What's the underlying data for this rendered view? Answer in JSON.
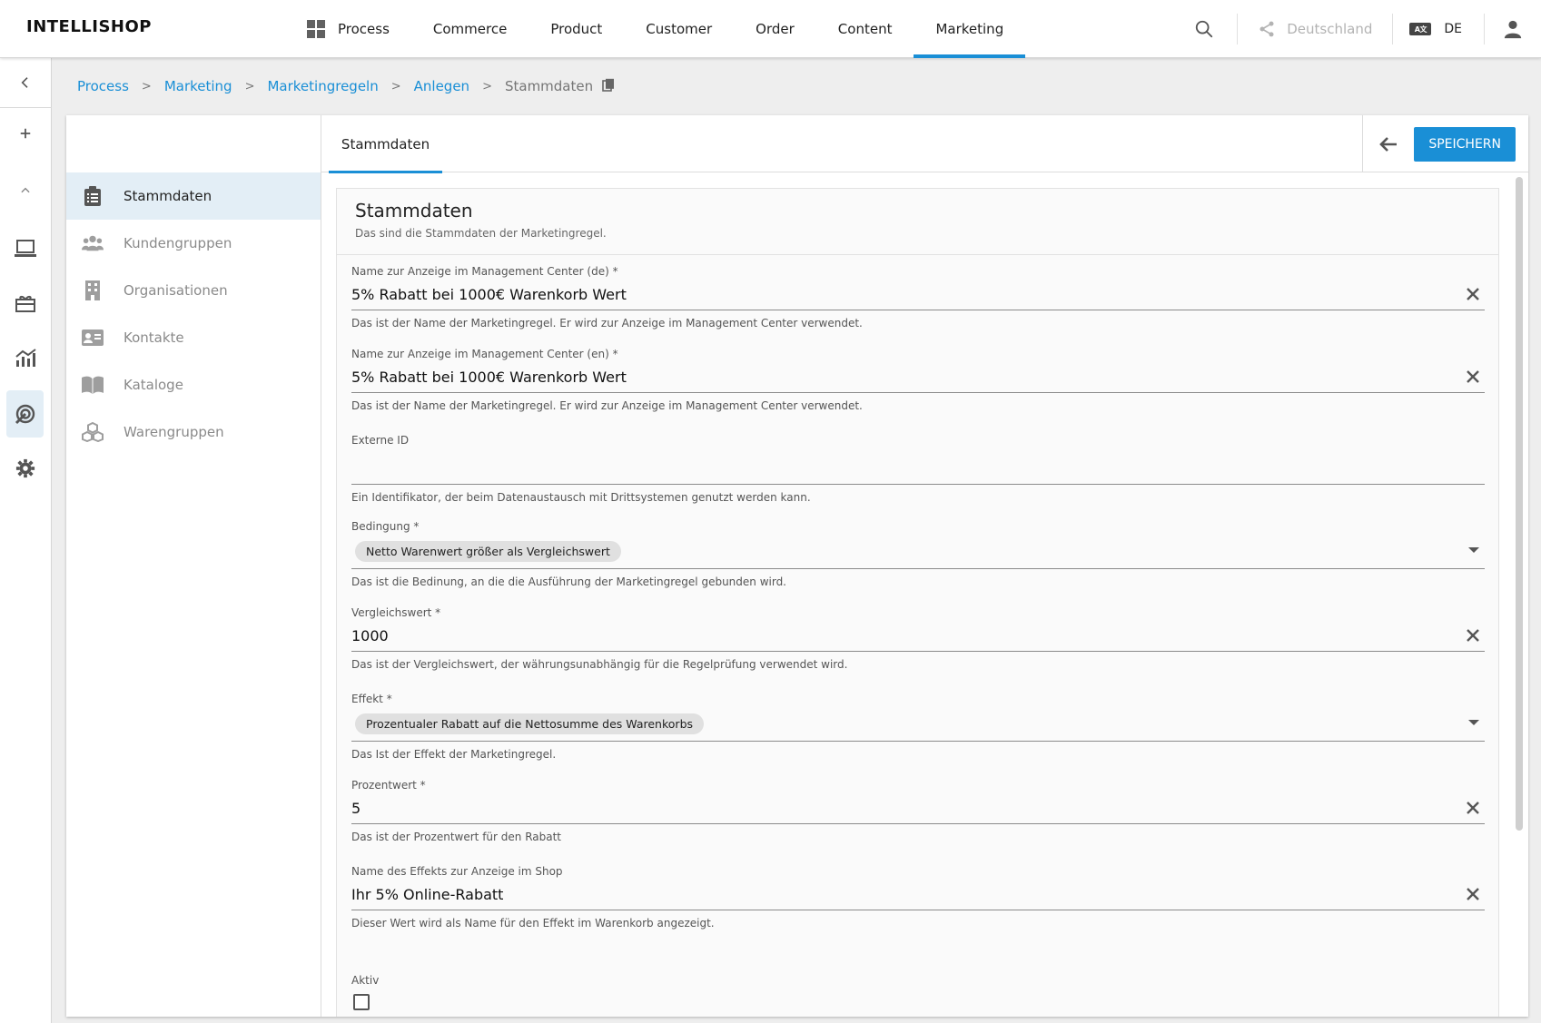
{
  "app": {
    "logo": "INTELLISHOP"
  },
  "nav": {
    "items": [
      {
        "label": "Process"
      },
      {
        "label": "Commerce"
      },
      {
        "label": "Product"
      },
      {
        "label": "Customer"
      },
      {
        "label": "Order"
      },
      {
        "label": "Content"
      },
      {
        "label": "Marketing",
        "active": true
      }
    ]
  },
  "topright": {
    "country": "Deutschland",
    "language": "DE"
  },
  "breadcrumb": {
    "items": [
      "Process",
      "Marketing",
      "Marketingregeln",
      "Anlegen"
    ],
    "current": "Stammdaten"
  },
  "side": {
    "items": [
      {
        "label": "Stammdaten",
        "icon": "clipboard-icon",
        "active": true
      },
      {
        "label": "Kundengruppen",
        "icon": "people-icon"
      },
      {
        "label": "Organisationen",
        "icon": "building-icon"
      },
      {
        "label": "Kontakte",
        "icon": "contact-card-icon"
      },
      {
        "label": "Kataloge",
        "icon": "book-icon"
      },
      {
        "label": "Warengruppen",
        "icon": "cubes-icon"
      }
    ]
  },
  "tabs": {
    "active": "Stammdaten"
  },
  "actions": {
    "save": "SPEICHERN"
  },
  "form": {
    "title": "Stammdaten",
    "subtitle": "Das sind die Stammdaten der Marketingregel.",
    "fields": {
      "name_de": {
        "label": "Name zur Anzeige im Management Center (de) *",
        "value": "5% Rabatt bei 1000€ Warenkorb Wert",
        "hint": "Das ist der Name der Marketingregel. Er wird zur Anzeige im Management Center verwendet."
      },
      "name_en": {
        "label": "Name zur Anzeige im Management Center (en) *",
        "value": "5% Rabatt bei 1000€ Warenkorb Wert",
        "hint": "Das ist der Name der Marketingregel. Er wird zur Anzeige im Management Center verwendet."
      },
      "external_id": {
        "label": "Externe ID",
        "value": "",
        "hint": "Ein Identifikator, der beim Datenaustausch mit Drittsystemen genutzt werden kann."
      },
      "condition": {
        "label": "Bedingung *",
        "value": "Netto Warenwert größer als Vergleichswert",
        "hint": "Das ist die Bedinung, an die die Ausführung der Marketingregel gebunden wird."
      },
      "compare_value": {
        "label": "Vergleichswert *",
        "value": "1000",
        "hint": "Das ist der Vergleichswert, der währungsunabhängig für die Regelprüfung verwendet wird."
      },
      "effect": {
        "label": "Effekt *",
        "value": "Prozentualer Rabatt auf die Nettosumme des Warenkorbs",
        "hint": "Das Ist der Effekt der Marketingregel."
      },
      "percent": {
        "label": "Prozentwert *",
        "value": "5",
        "hint": "Das ist der Prozentwert für den Rabatt"
      },
      "shop_name": {
        "label": "Name des Effekts zur Anzeige im Shop",
        "value": "Ihr 5% Online-Rabatt",
        "hint": "Dieser Wert wird als Name für den Effekt im Warenkorb angezeigt."
      },
      "active": {
        "label": "Aktiv",
        "checked": false
      }
    }
  },
  "colors": {
    "accent": "#1a8fd6",
    "active_bg": "#e3eef6"
  }
}
